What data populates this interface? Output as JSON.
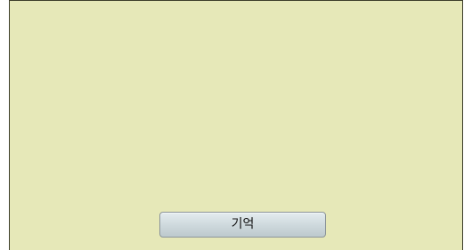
{
  "colors": {
    "panel_background": "#e6e8b8",
    "panel_border": "#3d3d2a",
    "button_background": "#cdd8dc"
  },
  "panel": {
    "button_label": "기억"
  }
}
